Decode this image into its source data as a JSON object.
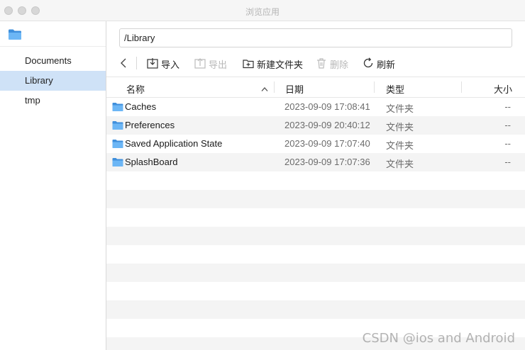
{
  "window": {
    "title": "浏览应用"
  },
  "sidebar": {
    "items": [
      {
        "label": "Documents",
        "selected": false
      },
      {
        "label": "Library",
        "selected": true
      },
      {
        "label": "tmp",
        "selected": false
      }
    ]
  },
  "path": {
    "value": "/Library"
  },
  "toolbar": {
    "import_label": "导入",
    "export_label": "导出",
    "new_folder_label": "新建文件夹",
    "delete_label": "删除",
    "refresh_label": "刷新"
  },
  "table": {
    "headers": {
      "name": "名称",
      "date": "日期",
      "kind": "类型",
      "size": "大小"
    },
    "rows": [
      {
        "name": "Caches",
        "date": "2023-09-09 17:08:41",
        "kind": "文件夹",
        "size": "--"
      },
      {
        "name": "Preferences",
        "date": "2023-09-09 20:40:12",
        "kind": "文件夹",
        "size": "--"
      },
      {
        "name": "Saved Application State",
        "date": "2023-09-09 17:07:40",
        "kind": "文件夹",
        "size": "--"
      },
      {
        "name": "SplashBoard",
        "date": "2023-09-09 17:07:36",
        "kind": "文件夹",
        "size": "--"
      }
    ]
  },
  "watermark": "CSDN @ios and Android",
  "colors": {
    "selection": "#cfe2f7",
    "folder": "#5aa9f0",
    "row_alt": "#f4f4f4"
  }
}
